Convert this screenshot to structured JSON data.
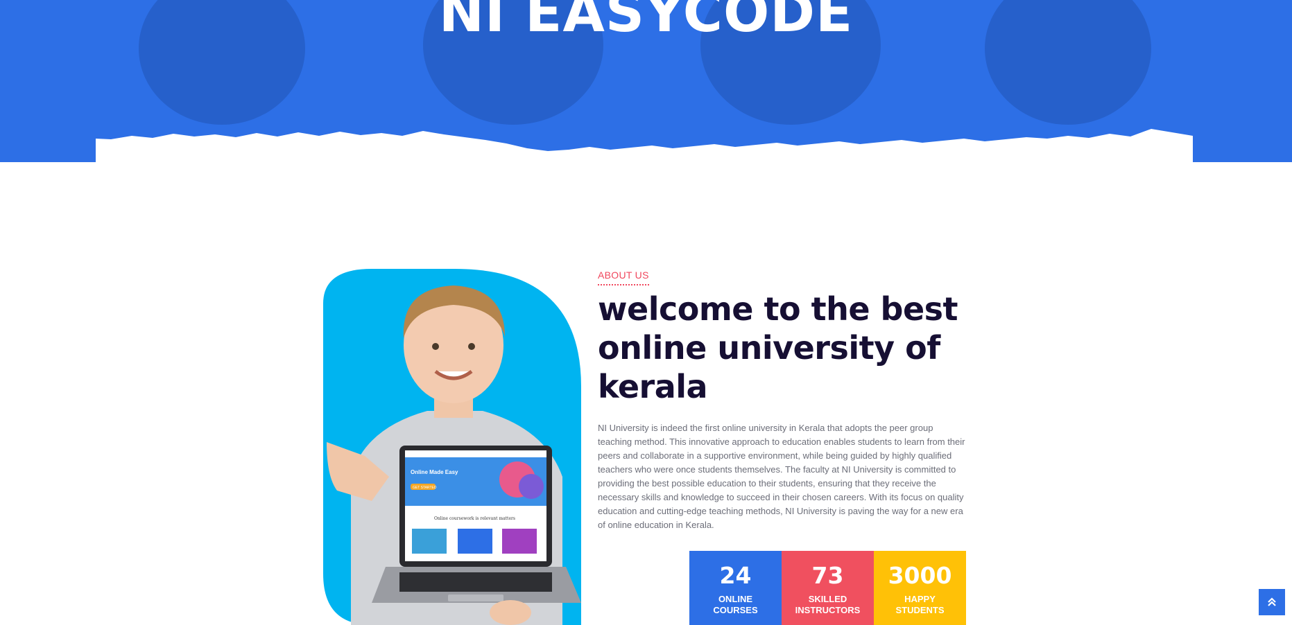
{
  "hero": {
    "title": "NI EASYCODE"
  },
  "about": {
    "eyebrow": "ABOUT US",
    "heading_lines": [
      "welcome to the best",
      "online university of",
      "kerala"
    ],
    "body": "NI University is indeed the first online university in Kerala that adopts the peer group teaching method. This innovative approach to education enables students to learn from their peers and collaborate in a supportive environment, while being guided by highly qualified teachers who were once students themselves. The faculty at NI University is committed to providing the best possible education to their students, ensuring that they receive the necessary skills and knowledge to succeed in their chosen careers. With its focus on quality education and cutting-edge teaching methods, NI University is paving the way for a new era of online education in Kerala.",
    "laptop_screen": {
      "headline": "Online Made Easy",
      "section": "Online coursework is relevant matters",
      "button": "GET STARTED"
    }
  },
  "stats": [
    {
      "value": "24",
      "label_1": "ONLINE",
      "label_2": "COURSES",
      "color": "#2d6fe6"
    },
    {
      "value": "73",
      "label_1": "SKILLED",
      "label_2": "INSTRUCTORS",
      "color": "#f0505f"
    },
    {
      "value": "3000",
      "label_1": "HAPPY",
      "label_2": "STUDENTS",
      "color": "#ffc107"
    }
  ],
  "scroll_top": {
    "icon": "double-chevron-up-icon"
  },
  "colors": {
    "primary": "#2d6fe6",
    "accent": "#f0465c",
    "heading": "#160f33",
    "yellow": "#ffc107",
    "image_bg": "#00b4f0"
  }
}
